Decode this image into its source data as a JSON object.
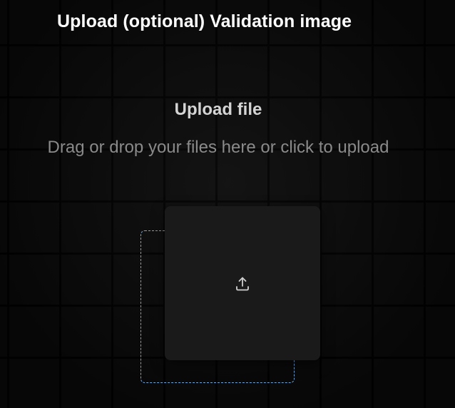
{
  "page": {
    "title": "Upload (optional) Validation image"
  },
  "upload": {
    "heading": "Upload file",
    "hint": "Drag or drop your files here or click to upload",
    "icon": "upload-icon"
  },
  "colors": {
    "background": "#0a0a0a",
    "card": "#1a1a1a",
    "dashed_border": "#6fa4d8",
    "heading_text": "#d4d4d4",
    "hint_text": "#8a8a8a"
  }
}
